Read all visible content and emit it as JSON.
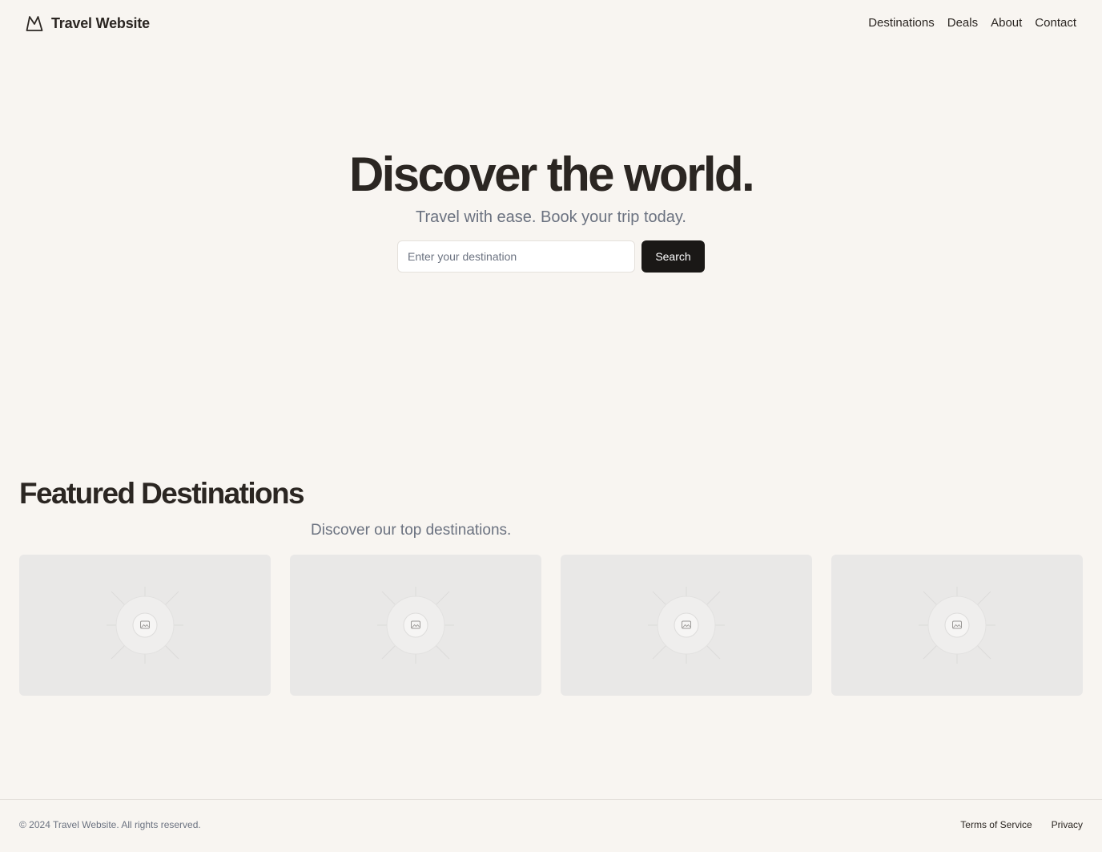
{
  "header": {
    "brand_name": "Travel Website",
    "brand_icon": "mountain-icon",
    "nav": [
      {
        "label": "Destinations"
      },
      {
        "label": "Deals"
      },
      {
        "label": "About"
      },
      {
        "label": "Contact"
      }
    ]
  },
  "hero": {
    "title": "Discover the world.",
    "subtitle": "Travel with ease. Book your trip today.",
    "search": {
      "placeholder": "Enter your destination",
      "value": "",
      "button_label": "Search"
    }
  },
  "featured": {
    "title": "Featured Destinations",
    "subtitle": "Discover our top destinations.",
    "cards": [
      {
        "image_icon": "image-placeholder-icon"
      },
      {
        "image_icon": "image-placeholder-icon"
      },
      {
        "image_icon": "image-placeholder-icon"
      },
      {
        "image_icon": "image-placeholder-icon"
      }
    ]
  },
  "footer": {
    "copyright": "© 2024 Travel Website. All rights reserved.",
    "links": [
      {
        "label": "Terms of Service"
      },
      {
        "label": "Privacy"
      }
    ]
  },
  "colors": {
    "background": "#f8f5f1",
    "text": "#2b2622",
    "muted": "#6b7280",
    "button": "#1a1816",
    "card": "#e9e8e7"
  }
}
